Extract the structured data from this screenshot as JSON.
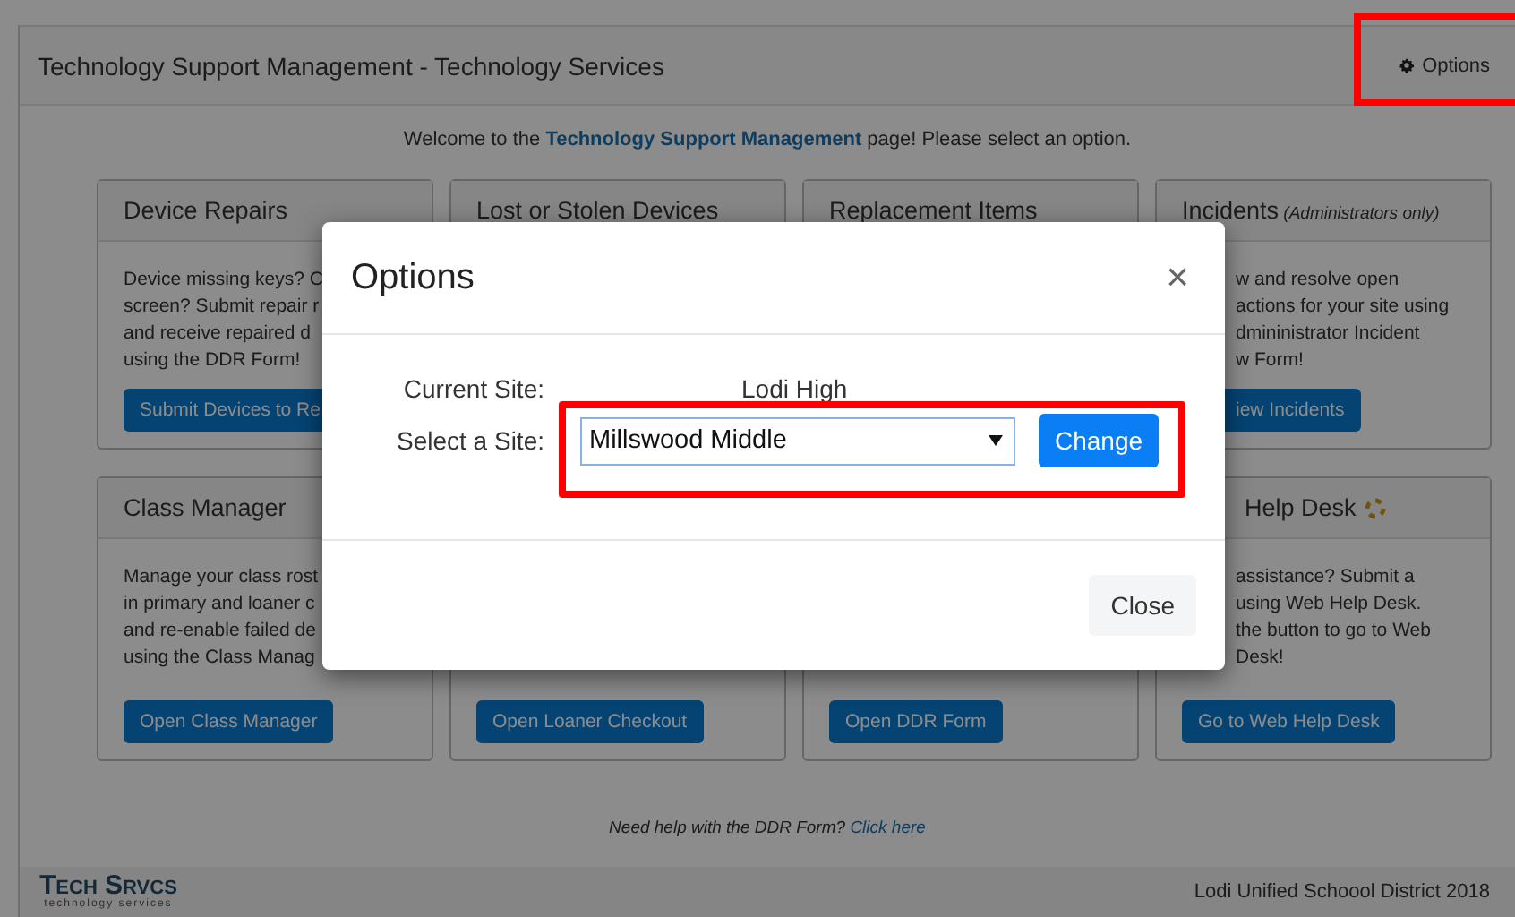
{
  "header": {
    "title": "Technology Support Management - Technology Services",
    "options_button": "Options"
  },
  "welcome": "Welcome to the **Technology Support Management** page! Please select an option.",
  "cards": [
    {
      "title": "Device Repairs",
      "lines": [
        "Device missing keys? C",
        "screen? Submit repair r",
        "and receive repaired d",
        "using the DDR Form!"
      ],
      "button": "Submit Devices to Re"
    },
    {
      "title": "Lost or Stolen Devices"
    },
    {
      "title": "Replacement Items"
    },
    {
      "title": "Incidents",
      "subtitle": "(Administrators only)",
      "lines": [
        "w and resolve open",
        "actions for your site using",
        "dmininistrator Incident",
        "w Form!"
      ],
      "button": "iew Incidents"
    },
    {
      "title": "Class Manager",
      "lines": [
        "Manage your class rost",
        "in primary and loaner c",
        "and re-enable failed de",
        "using the Class Manag"
      ],
      "button": "Open Class Manager"
    },
    {
      "button": "Open Loaner Checkout"
    },
    {
      "button": "Open DDR Form"
    },
    {
      "title": "Help Desk",
      "has_icon": true,
      "lines": [
        "assistance? Submit a",
        "using Web Help Desk.",
        "the button to go to Web",
        "Desk!"
      ],
      "button": "Go to Web Help Desk"
    }
  ],
  "help_note": {
    "text": "Need help with the DDR Form?",
    "link": "Click here"
  },
  "footer": {
    "logo": "Tech Srvcs",
    "logo_sub": "technology services",
    "copyright": "Lodi Unified Schoool District 2018"
  },
  "modal": {
    "title": "Options",
    "close": "×",
    "current_label": "Current Site:",
    "current_value": "Lodi High",
    "select_label": "Select a Site:",
    "select_value": "Millswood Middle",
    "change_button": "Change",
    "close_button": "Close"
  }
}
